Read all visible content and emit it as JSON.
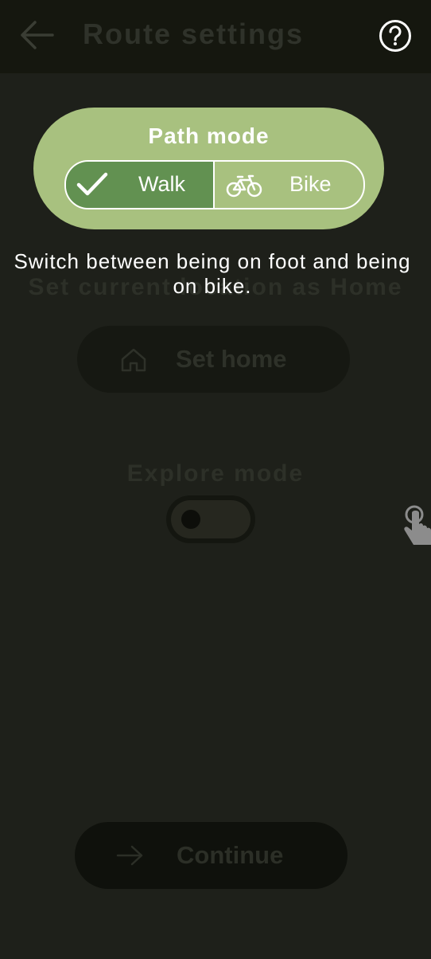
{
  "header": {
    "title": "Route settings",
    "back_icon": "arrow-left-icon",
    "help_icon": "question-circle-icon"
  },
  "background": {
    "caption": "Set current location as Home",
    "set_home_label": "Set home",
    "set_home_icon": "home-icon",
    "explore_mode_label": "Explore mode",
    "explore_mode_on": false,
    "continue_label": "Continue",
    "continue_icon": "arrow-right-icon"
  },
  "tutorial": {
    "card_title": "Path mode",
    "options": [
      {
        "label": "Walk",
        "icon": "check-icon",
        "selected": true
      },
      {
        "label": "Bike",
        "icon": "bicycle-icon",
        "selected": false
      }
    ],
    "description": "Switch between being on foot and being on bike.",
    "hint_icon": "tap-hand-icon"
  },
  "colors": {
    "card": "#a8c17f",
    "selected_segment": "#629151",
    "overlay_bg": "#1e201a"
  }
}
